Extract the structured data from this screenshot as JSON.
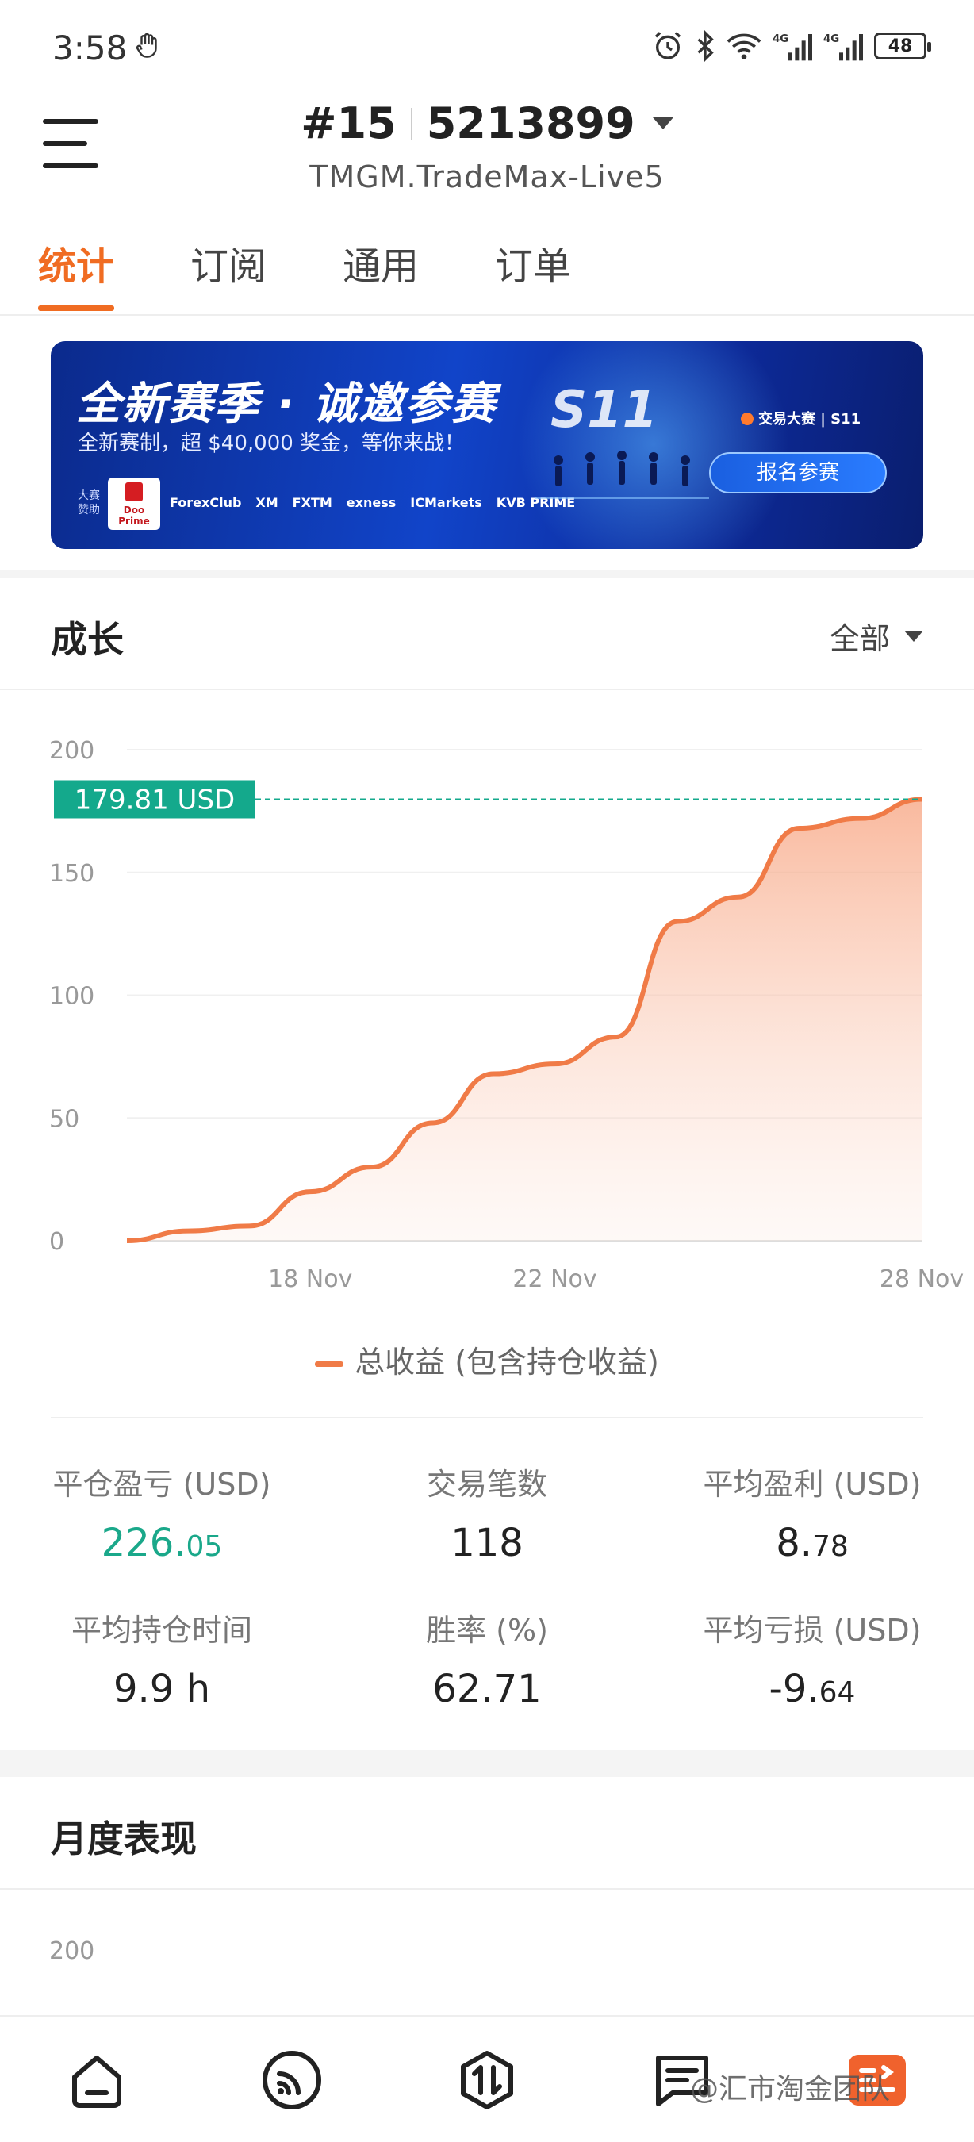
{
  "status_bar": {
    "time": "3:58",
    "battery": "48",
    "icons": [
      "hand-icon",
      "alarm-icon",
      "bluetooth-icon",
      "wifi-icon",
      "signal-4g-icon",
      "signal-4g-icon",
      "battery-icon"
    ]
  },
  "header": {
    "rank": "#15",
    "account_id": "5213899",
    "server": "TMGM.TradeMax-Live5"
  },
  "tabs": [
    {
      "label": "统计",
      "active": true
    },
    {
      "label": "订阅",
      "active": false
    },
    {
      "label": "通用",
      "active": false
    },
    {
      "label": "订单",
      "active": false
    }
  ],
  "banner": {
    "title": "全新赛季 · 诚邀参赛",
    "subtitle": "全新赛制，超 $40,000 奖金，等你来战！",
    "sponsor_label": "大赛赞助",
    "sponsor_main": "Doo Prime",
    "sponsors": [
      "ForexClub",
      "XM",
      "FXTM",
      "exness",
      "ICMarkets",
      "KVB PRIME"
    ],
    "season": "S11",
    "brand": "交易大赛 | S11",
    "button": "报名参赛"
  },
  "growth": {
    "title": "成长",
    "filter": "全部",
    "current_label": "179.81 USD",
    "legend": "总收益 (包含持仓收益)"
  },
  "chart_data": {
    "type": "area",
    "x": [
      "15 Nov",
      "16 Nov",
      "17 Nov",
      "18 Nov",
      "19 Nov",
      "20 Nov",
      "21 Nov",
      "22 Nov",
      "23 Nov",
      "24 Nov",
      "25 Nov",
      "26 Nov",
      "27 Nov",
      "28 Nov"
    ],
    "series": [
      {
        "name": "总收益 (包含持仓收益)",
        "values": [
          0,
          4,
          6,
          20,
          30,
          48,
          68,
          72,
          83,
          130,
          140,
          168,
          172,
          179.81
        ]
      }
    ],
    "xticks": [
      "18 Nov",
      "22 Nov",
      "28 Nov"
    ],
    "yticks": [
      0,
      50,
      100,
      150,
      200
    ],
    "ylim": [
      0,
      200
    ],
    "last_value_label": "179.81 USD",
    "line_color": "#f07b47",
    "label_color": "#14a98c",
    "grid": true
  },
  "stats": [
    {
      "label": "平仓盈亏 (USD)",
      "value_main": "226.",
      "value_small": "05",
      "color": "#1aa88a"
    },
    {
      "label": "交易笔数",
      "value_main": "118",
      "value_small": ""
    },
    {
      "label": "平均盈利 (USD)",
      "value_main": "8.",
      "value_small": "78"
    },
    {
      "label": "平均持仓时间",
      "value_main": "9.9 h",
      "value_small": ""
    },
    {
      "label": "胜率 (%)",
      "value_main": "62.71",
      "value_small": ""
    },
    {
      "label": "平均亏损 (USD)",
      "value_main": "-9.",
      "value_small": "64"
    }
  ],
  "monthly": {
    "title": "月度表现",
    "first_tick": "200"
  },
  "bottom_nav": [
    "home-icon",
    "feed-icon",
    "trade-icon",
    "messages-icon",
    "profile-icon"
  ],
  "watermark": "@汇市淘金团队",
  "colors": {
    "accent": "#f06c22",
    "positive": "#1aa88a"
  }
}
